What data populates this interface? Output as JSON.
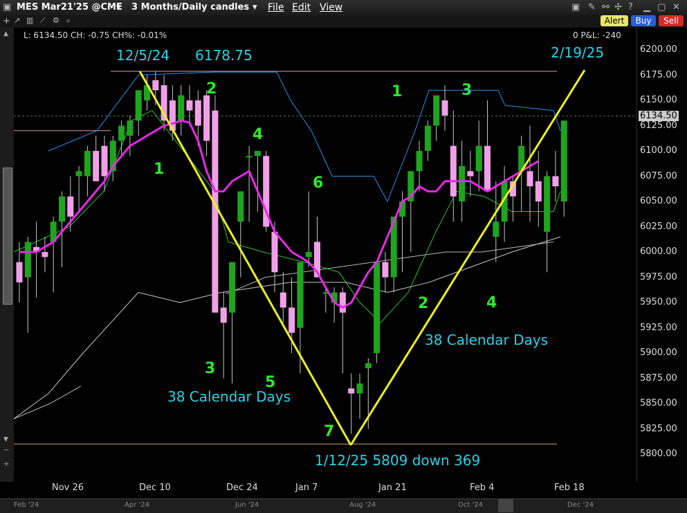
{
  "title_bar": {
    "symbol": "MES Mar21'25 @CME",
    "timeframe": "3 Months/Daily candles",
    "menus": [
      "File",
      "Edit",
      "View"
    ],
    "alert": "Alert",
    "buy": "Buy",
    "sell": "Sell"
  },
  "info_line": {
    "quote": "L: 6134.50 CH: -0.75 CH%: -0.01%",
    "pnl": "0 P&L: -240"
  },
  "price_axis": {
    "ticks": [
      "6200.00",
      "6175.00",
      "6150.00",
      "6125.00",
      "6100.00",
      "6075.00",
      "6050.00",
      "6025.00",
      "6000.00",
      "5975.00",
      "5950.00",
      "5925.00",
      "5900.00",
      "5875.00",
      "5850.00",
      "5825.00",
      "5800.00"
    ],
    "last_price": "6134.50"
  },
  "time_axis": [
    "Nov 26",
    "Dec 10",
    "Dec 24",
    "Jan 7",
    "Jan 21",
    "Feb 4",
    "Feb 18"
  ],
  "navigator": [
    "Feb '24",
    "Apr '24",
    "Jun '24",
    "Aug '24",
    "Oct '24",
    "Dec '24"
  ],
  "annotations": {
    "top_date": "12/5/24",
    "top_price": "6178.75",
    "right_date": "2/19/25",
    "bottom": "1/12/25 5809 down 369",
    "days_left": "38 Calendar Days",
    "days_right": "38 Calendar Days",
    "counts": [
      "1",
      "2",
      "3",
      "4",
      "5",
      "6",
      "7",
      "1",
      "2",
      "3",
      "4"
    ]
  },
  "chart_data": {
    "type": "candlestick",
    "ylim": [
      5780,
      6210
    ],
    "candles": [
      [
        5990,
        6010,
        5950,
        5970
      ],
      [
        5975,
        6015,
        5920,
        6010
      ],
      [
        6005,
        6030,
        5955,
        6000
      ],
      [
        6000,
        6015,
        5980,
        5995
      ],
      [
        6010,
        6035,
        5960,
        6030
      ],
      [
        6030,
        6060,
        5985,
        6055
      ],
      [
        6055,
        6075,
        6020,
        6035
      ],
      [
        6075,
        6085,
        6040,
        6080
      ],
      [
        6075,
        6105,
        6055,
        6100
      ],
      [
        6100,
        6115,
        6070,
        6070
      ],
      [
        6105,
        6115,
        6060,
        6075
      ],
      [
        6080,
        6115,
        6070,
        6110
      ],
      [
        6110,
        6130,
        6095,
        6125
      ],
      [
        6115,
        6135,
        6095,
        6130
      ],
      [
        6130,
        6160,
        6115,
        6160
      ],
      [
        6150,
        6175,
        6140,
        6165
      ],
      [
        6170,
        6178.75,
        6145,
        6160
      ],
      [
        6165,
        6175,
        6120,
        6130
      ],
      [
        6150,
        6165,
        6110,
        6120
      ],
      [
        6130,
        6165,
        6115,
        6155
      ],
      [
        6150,
        6165,
        6125,
        6140
      ],
      [
        6150,
        6160,
        6105,
        6125
      ],
      [
        6155,
        6160,
        6095,
        6110
      ],
      [
        6140,
        6155,
        6060,
        5940
      ],
      [
        5945,
        5960,
        5875,
        5930
      ],
      [
        5940,
        5990,
        5870,
        5990
      ],
      [
        6030,
        6050,
        5975,
        6060
      ],
      [
        6095,
        6105,
        6030,
        6095
      ],
      [
        6095,
        6100,
        6040,
        6100
      ],
      [
        6095,
        6100,
        6020,
        6025
      ],
      [
        6020,
        6030,
        5960,
        5980
      ],
      [
        5960,
        5980,
        5930,
        5945
      ],
      [
        5945,
        5975,
        5900,
        5920
      ],
      [
        5925,
        5990,
        5880,
        5990
      ],
      [
        5995,
        6060,
        5985,
        6000
      ],
      [
        6010,
        6035,
        5980,
        5975
      ],
      [
        5960,
        5965,
        5940,
        5960
      ],
      [
        5950,
        5965,
        5930,
        5960
      ],
      [
        5960,
        5965,
        5880,
        5940
      ],
      [
        5865,
        5880,
        5820,
        5860
      ],
      [
        5860,
        5880,
        5835,
        5870
      ],
      [
        5885,
        5895,
        5825,
        5890
      ],
      [
        5900,
        5990,
        5890,
        5990
      ],
      [
        5990,
        6000,
        5960,
        5975
      ],
      [
        5975,
        6030,
        5960,
        6035
      ],
      [
        6035,
        6060,
        5980,
        6050
      ],
      [
        6050,
        6055,
        6000,
        6080
      ],
      [
        6080,
        6110,
        6060,
        6100
      ],
      [
        6100,
        6130,
        6090,
        6125
      ],
      [
        6125,
        6150,
        6110,
        6155
      ],
      [
        6150,
        6165,
        6120,
        6135
      ],
      [
        6105,
        6140,
        6030,
        6055
      ],
      [
        6050,
        6110,
        6030,
        6085
      ],
      [
        6080,
        6100,
        6055,
        6075
      ],
      [
        6080,
        6130,
        6060,
        6105
      ],
      [
        6105,
        6150,
        6070,
        6060
      ],
      [
        6015,
        6070,
        5990,
        6030
      ],
      [
        6030,
        6085,
        6010,
        6070
      ],
      [
        6070,
        6075,
        6030,
        6055
      ],
      [
        6080,
        6115,
        6040,
        6105
      ],
      [
        6080,
        6125,
        6030,
        6065
      ],
      [
        6070,
        6100,
        6025,
        6050
      ],
      [
        6020,
        6080,
        5980,
        6075
      ],
      [
        6075,
        6100,
        6050,
        6065
      ],
      [
        6050,
        6085,
        6035,
        6130
      ]
    ],
    "sma_magenta": [
      6000,
      6000,
      6000,
      6005,
      6010,
      6020,
      6030,
      6040,
      6050,
      6060,
      6070,
      6085,
      6095,
      6105,
      6110,
      6115,
      6120,
      6125,
      6127,
      6130,
      6128,
      6110,
      6080,
      6060,
      6060,
      6070,
      6075,
      6080,
      6060,
      6040,
      6020,
      6010,
      6000,
      5995,
      5990,
      5980,
      5965,
      5950,
      5945,
      5950,
      5965,
      5980,
      5990,
      6010,
      6030,
      6050,
      6055,
      6065,
      6060,
      6060,
      6070,
      6070,
      6070,
      6070,
      6065,
      6060,
      6065,
      6070,
      6075,
      6080,
      6085,
      6090
    ],
    "upper_line_y": 6178.75,
    "lower_line_y": 5809
  }
}
